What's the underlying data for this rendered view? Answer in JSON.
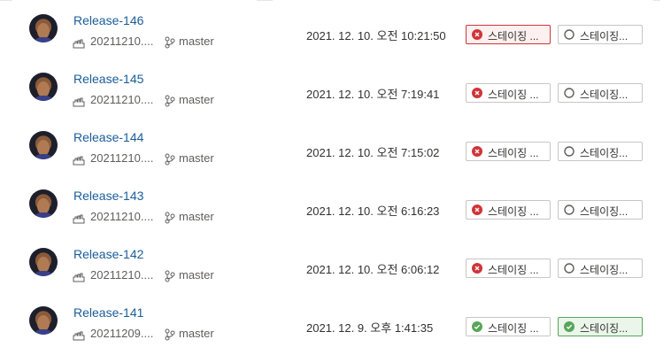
{
  "releases": [
    {
      "name": "Release-146",
      "build": "20211210....",
      "branch": "master",
      "date": "2021. 12. 10. 오전 10:21:50",
      "stages": [
        {
          "label": "스테이징 ...",
          "status": "failed",
          "highlight": true
        },
        {
          "label": "스테이징...",
          "status": "not-started",
          "highlight": false
        }
      ]
    },
    {
      "name": "Release-145",
      "build": "20211210....",
      "branch": "master",
      "date": "2021. 12. 10. 오전 7:19:41",
      "stages": [
        {
          "label": "스테이징 ...",
          "status": "failed",
          "highlight": false
        },
        {
          "label": "스테이징...",
          "status": "not-started",
          "highlight": false
        }
      ]
    },
    {
      "name": "Release-144",
      "build": "20211210....",
      "branch": "master",
      "date": "2021. 12. 10. 오전 7:15:02",
      "stages": [
        {
          "label": "스테이징 ...",
          "status": "failed",
          "highlight": false
        },
        {
          "label": "스테이징...",
          "status": "not-started",
          "highlight": false
        }
      ]
    },
    {
      "name": "Release-143",
      "build": "20211210....",
      "branch": "master",
      "date": "2021. 12. 10. 오전 6:16:23",
      "stages": [
        {
          "label": "스테이징 ...",
          "status": "failed",
          "highlight": false
        },
        {
          "label": "스테이징...",
          "status": "not-started",
          "highlight": false
        }
      ]
    },
    {
      "name": "Release-142",
      "build": "20211210....",
      "branch": "master",
      "date": "2021. 12. 10. 오전 6:06:12",
      "stages": [
        {
          "label": "스테이징 ...",
          "status": "failed",
          "highlight": false
        },
        {
          "label": "스테이징...",
          "status": "not-started",
          "highlight": false
        }
      ]
    },
    {
      "name": "Release-141",
      "build": "20211209....",
      "branch": "master",
      "date": "2021. 12. 9. 오후 1:41:35",
      "stages": [
        {
          "label": "스테이징 ...",
          "status": "succeeded",
          "highlight": false
        },
        {
          "label": "스테이징...",
          "status": "succeeded",
          "highlight": true
        }
      ]
    }
  ],
  "icons": {
    "build": "build-pipeline-icon",
    "branch": "git-branch-icon",
    "failed": "error-circle-icon",
    "succeeded": "check-circle-icon",
    "not-started": "empty-circle-icon"
  },
  "colors": {
    "link": "#1a5c9a",
    "failed": "#d13438",
    "succeeded": "#57a55a",
    "neutral": "#605e5c"
  }
}
